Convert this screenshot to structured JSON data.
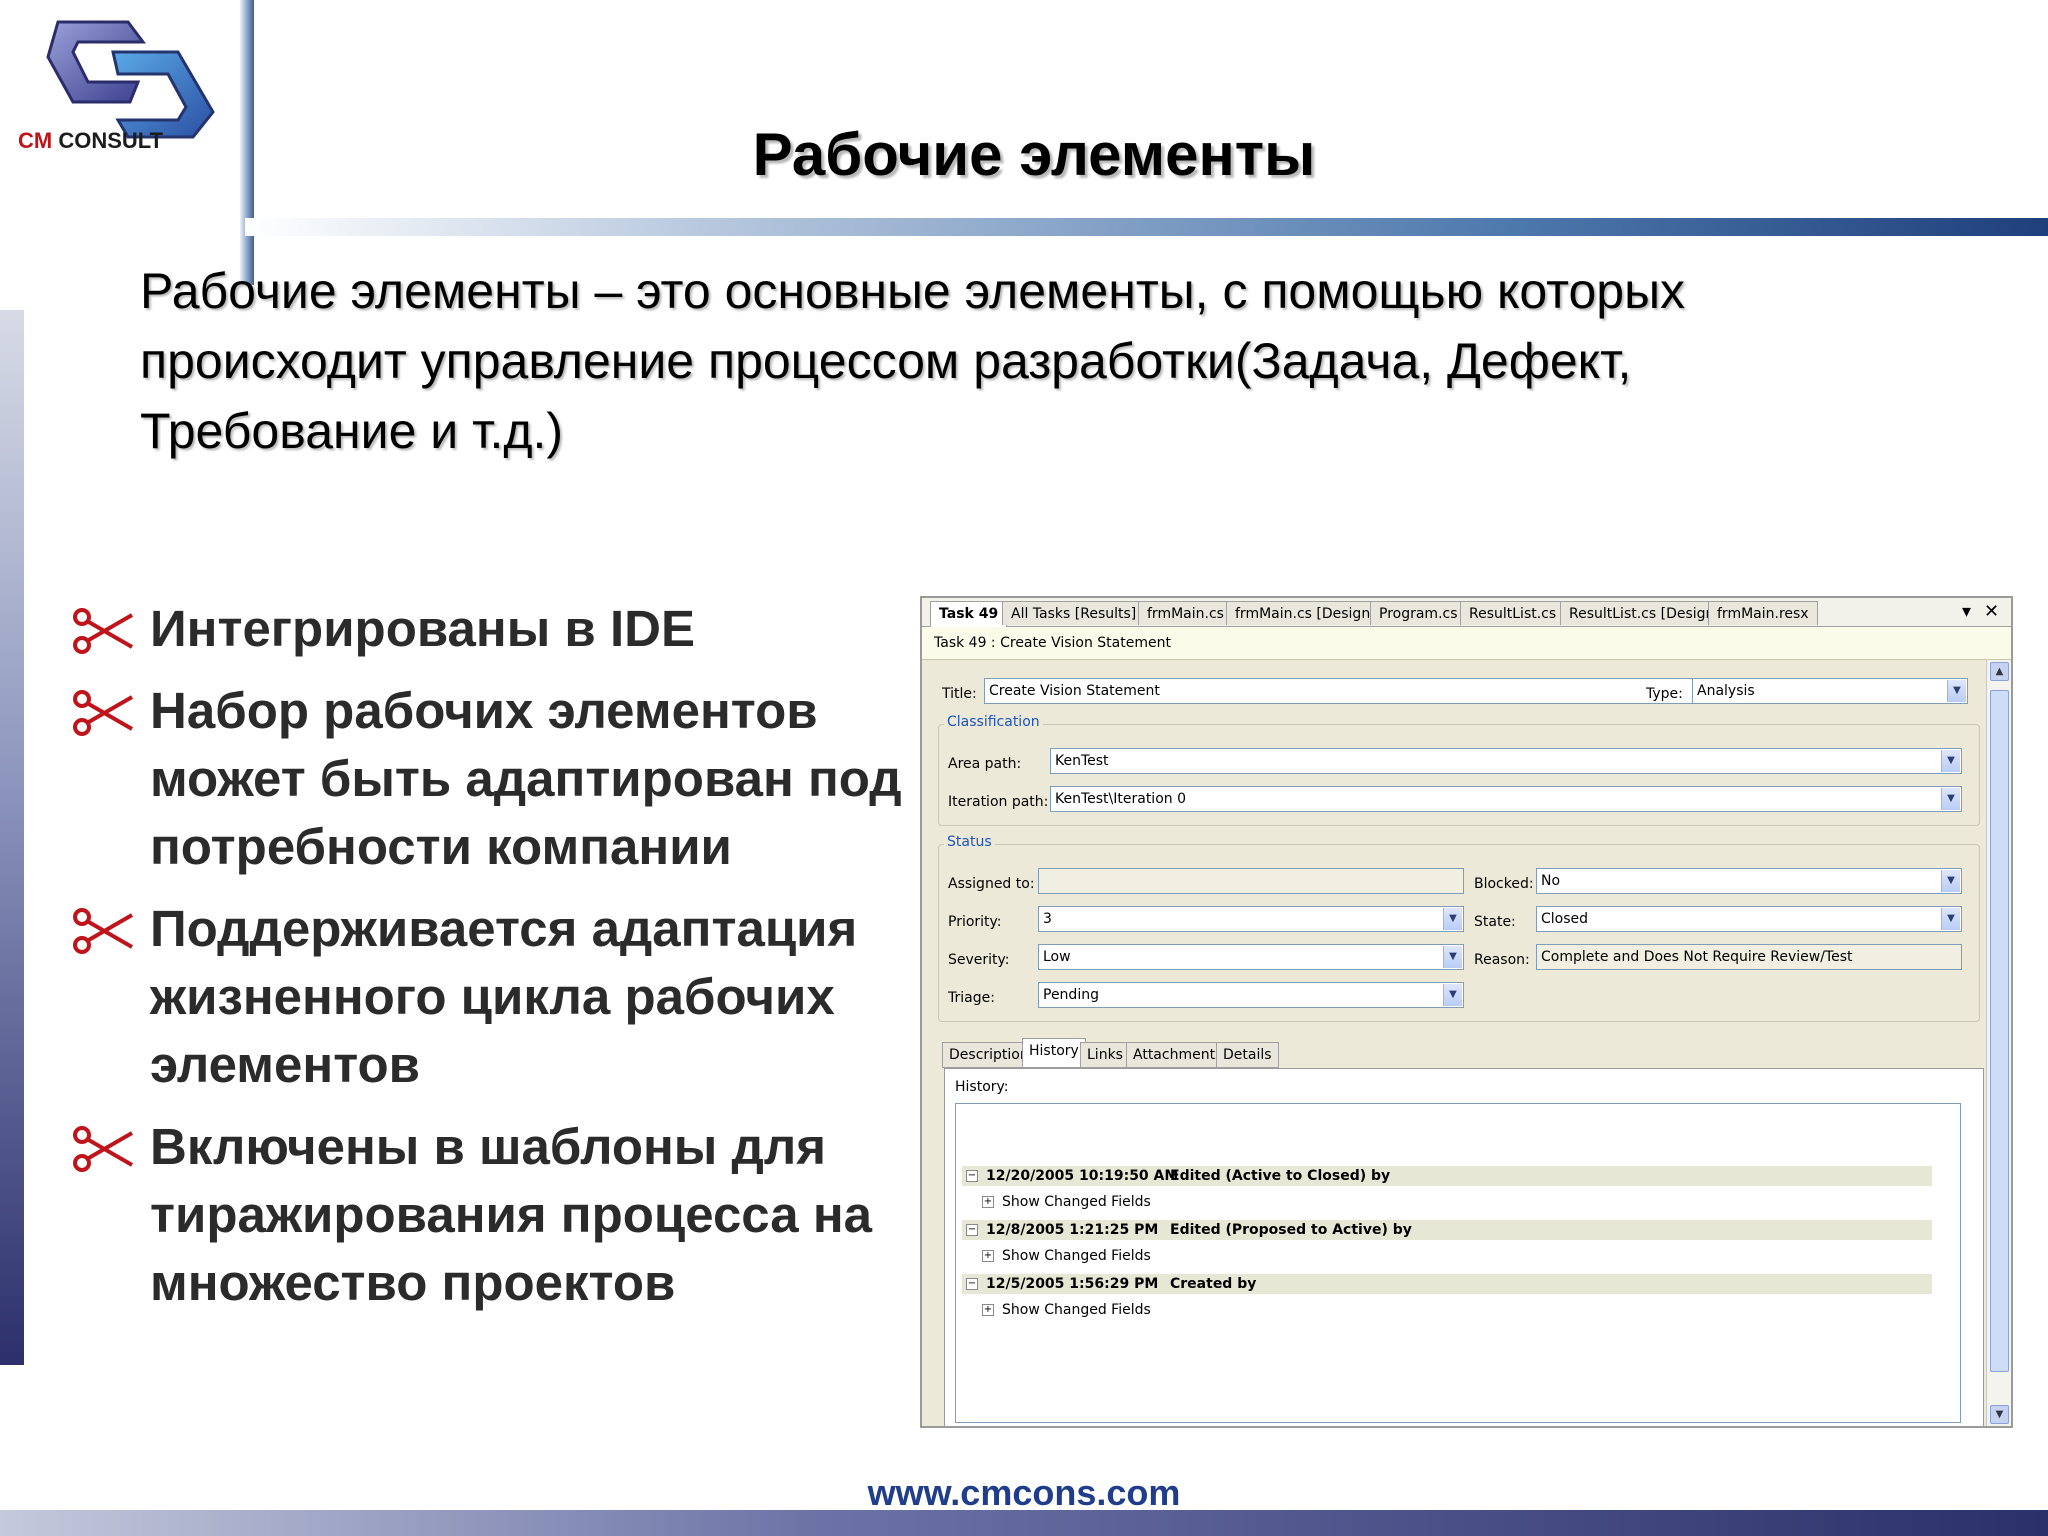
{
  "logo": {
    "cm": "CM",
    "consult": "CONSULT"
  },
  "slide": {
    "title": "Рабочие элементы",
    "intro_line1": "Рабочие элементы – это основные элементы, с помощью которых",
    "intro_line2": "происходит управление процессом разработки(Задача, Дефект,",
    "intro_line3": "Требование и т.д.)",
    "bullets": [
      "Интегрированы в IDE",
      "Набор рабочих элементов может быть адаптирован под потребности компании",
      "Поддерживается адаптация жизненного цикла рабочих элементов",
      "Включены в шаблоны для тиражирования процесса на множество проектов"
    ],
    "website": "www.cmcons.com"
  },
  "ide": {
    "tabs": [
      "Task 49",
      "All Tasks [Results]",
      "frmMain.cs",
      "frmMain.cs [Design]",
      "Program.cs",
      "ResultList.cs",
      "ResultList.cs [Design]",
      "frmMain.resx"
    ],
    "pin_icon": "▾",
    "close_icon": "✕",
    "doc_title": "Task 49 : Create Vision Statement",
    "title_label": "Title:",
    "title_value": "Create Vision Statement",
    "type_label": "Type:",
    "type_value": "Analysis",
    "classification_title": "Classification",
    "area_label": "Area path:",
    "area_value": "KenTest",
    "iteration_label": "Iteration path:",
    "iteration_value": "KenTest\\Iteration 0",
    "status_title": "Status",
    "assigned_label": "Assigned to:",
    "assigned_value": "",
    "blocked_label": "Blocked:",
    "blocked_value": "No",
    "priority_label": "Priority:",
    "priority_value": "3",
    "state_label": "State:",
    "state_value": "Closed",
    "severity_label": "Severity:",
    "severity_value": "Low",
    "reason_label": "Reason:",
    "reason_value": "Complete and Does Not Require Review/Test",
    "triage_label": "Triage:",
    "triage_value": "Pending",
    "subtabs": [
      "Description",
      "History",
      "Links",
      "Attachments",
      "Details"
    ],
    "history_label": "History:",
    "history": [
      {
        "timestamp": "12/20/2005 10:19:50 AM",
        "text": "Edited (Active to Closed) by",
        "changed": "Show Changed Fields"
      },
      {
        "timestamp": "12/8/2005 1:21:25 PM",
        "text": "Edited (Proposed to Active) by",
        "changed": "Show Changed Fields"
      },
      {
        "timestamp": "12/5/2005 1:56:29 PM",
        "text": "Created by",
        "changed": "Show Changed Fields"
      }
    ]
  }
}
